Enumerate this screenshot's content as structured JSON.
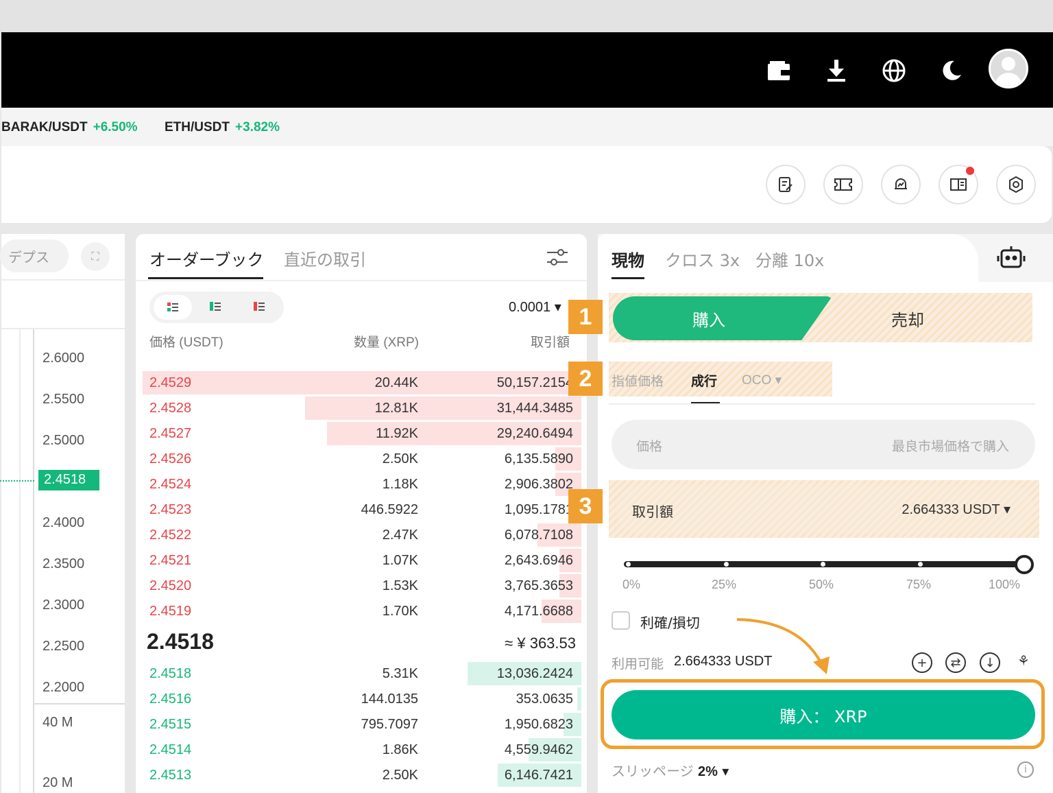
{
  "header": {
    "icons": [
      "wallet-icon",
      "download-icon",
      "globe-icon",
      "moon-icon",
      "avatar-icon"
    ]
  },
  "ticker": [
    {
      "pair": "BARAK/USDT",
      "change": "+6.50%"
    },
    {
      "pair": "ETH/USDT",
      "change": "+3.82%"
    }
  ],
  "toolbar": {
    "icons": [
      "note-icon",
      "ticket-icon",
      "bell-icon",
      "book-icon",
      "settings-icon"
    ]
  },
  "chart_panel": {
    "depth_tab": "デプス",
    "price_labels": [
      "2.6000",
      "2.5500",
      "2.5000",
      "2.4518",
      "2.4000",
      "2.3500",
      "2.3000",
      "2.2500",
      "2.2000"
    ],
    "volume_labels": [
      "40 M",
      "20 M"
    ],
    "current_price_color": "#14b87a"
  },
  "orderbook": {
    "tab_active": "オーダーブック",
    "tab_other": "直近の取引",
    "precision": "0.0001",
    "col_price": "価格 (USDT)",
    "col_qty": "数量 (XRP)",
    "col_total": "取引額",
    "asks": [
      {
        "price": "2.4529",
        "qty": "20.44K",
        "total": "50,157.2154",
        "fill": 1.0
      },
      {
        "price": "2.4528",
        "qty": "12.81K",
        "total": "31,444.3485",
        "fill": 0.63
      },
      {
        "price": "2.4527",
        "qty": "11.92K",
        "total": "29,240.6494",
        "fill": 0.58
      },
      {
        "price": "2.4526",
        "qty": "2.50K",
        "total": "6,135.5890",
        "fill": 0.06
      },
      {
        "price": "2.4524",
        "qty": "1.18K",
        "total": "2,906.3802",
        "fill": 0.06
      },
      {
        "price": "2.4523",
        "qty": "446.5922",
        "total": "1,095.1781",
        "fill": 0.02
      },
      {
        "price": "2.4522",
        "qty": "2.47K",
        "total": "6,078.7108",
        "fill": 0.1
      },
      {
        "price": "2.4521",
        "qty": "1.07K",
        "total": "2,643.6946",
        "fill": 0.05
      },
      {
        "price": "2.4520",
        "qty": "1.53K",
        "total": "3,765.3653",
        "fill": 0.05
      },
      {
        "price": "2.4519",
        "qty": "1.70K",
        "total": "4,171.6688",
        "fill": 0.09
      }
    ],
    "mid_price": "2.4518",
    "mid_fiat": "≈ ¥ 363.53",
    "bids": [
      {
        "price": "2.4518",
        "qty": "5.31K",
        "total": "13,036.2424",
        "fill": 0.26
      },
      {
        "price": "2.4516",
        "qty": "144.0135",
        "total": "353.0635",
        "fill": 0.01
      },
      {
        "price": "2.4515",
        "qty": "795.7097",
        "total": "1,950.6823",
        "fill": 0.04
      },
      {
        "price": "2.4514",
        "qty": "1.86K",
        "total": "4,559.9462",
        "fill": 0.12
      },
      {
        "price": "2.4513",
        "qty": "2.50K",
        "total": "6,146.7421",
        "fill": 0.19
      }
    ],
    "ask_color": "#e8444a",
    "bid_color": "#14b87a"
  },
  "trade_panel": {
    "tabs": [
      "現物",
      "クロス 3x",
      "分離 10x"
    ],
    "buy_label": "購入",
    "sell_label": "売却",
    "order_types": [
      "指値価格",
      "成行",
      "OCO"
    ],
    "price_label": "価格",
    "price_placeholder": "最良市場価格で購入",
    "amount_label": "取引額",
    "amount_value": "2.664333 USDT",
    "slider_value": 1.0,
    "slider_ticks": [
      "0%",
      "25%",
      "50%",
      "75%",
      "100%"
    ],
    "tpsl_label": "利確/損切",
    "available_label": "利用可能",
    "available_value": "2.664333 USDT",
    "submit_label": "購入： XRP",
    "slippage_label": "スリッページ",
    "slippage_value": "2%",
    "accent": "#00b890"
  },
  "annotations": {
    "badges": [
      "1",
      "2",
      "3"
    ],
    "highlight_color": "#f0a030"
  }
}
